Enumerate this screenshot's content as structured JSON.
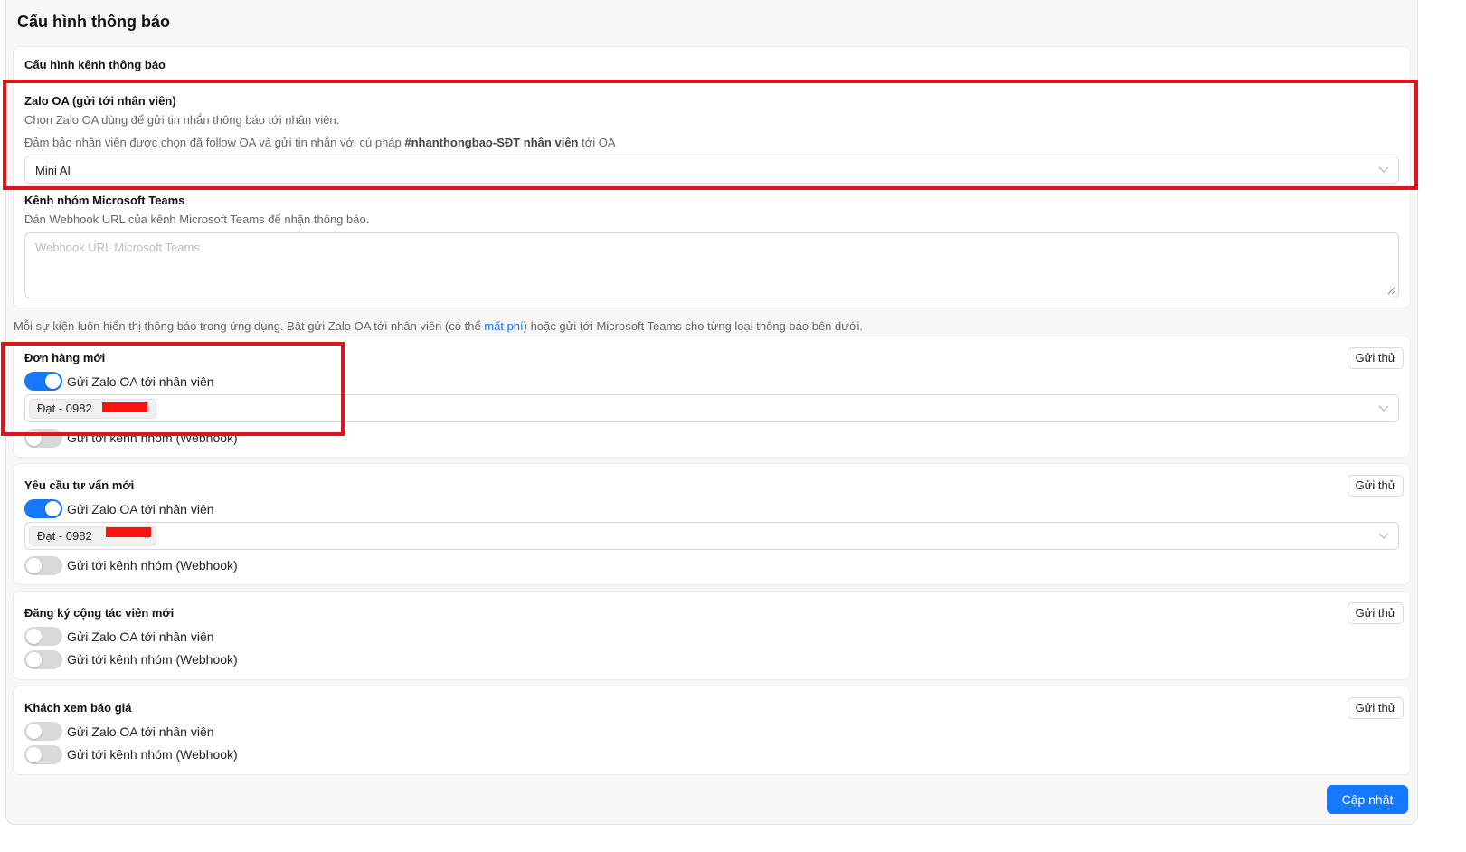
{
  "page": {
    "title": "Cấu hình thông báo"
  },
  "channels": {
    "section_title": "Cấu hình kênh thông báo",
    "zalo": {
      "label": "Zalo OA (gửi tới nhân viên)",
      "help1": "Chọn Zalo OA dùng để gửi tin nhắn thông báo tới nhân viên.",
      "help2_prefix": "Đảm bảo nhân viên được chọn đã follow OA và gửi tin nhắn với cú pháp ",
      "help2_syntax": "#nhanthongbao-SĐT nhân viên",
      "help2_suffix": " tới OA",
      "selected": "Mini AI"
    },
    "teams": {
      "label": "Kênh nhóm Microsoft Teams",
      "help": "Dán Webhook URL của kênh Microsoft Teams để nhận thông báo.",
      "placeholder": "Webhook URL Microsoft Teams"
    }
  },
  "note": {
    "prefix": "Mỗi sự kiện luôn hiển thị thông báo trong ứng dụng. Bật gửi Zalo OA tới nhân viên (có thể ",
    "link": "mất phí",
    "suffix": ") hoặc gửi tới Microsoft Teams cho từng loại thông báo bên dưới."
  },
  "events": [
    {
      "title": "Đơn hàng mới",
      "test_label": "Gửi thử",
      "zalo_label": "Gửi Zalo OA tới nhân viên",
      "zalo_on": true,
      "recipient": "Đạt - 0982",
      "webhook_label": "Gửi tới kênh nhóm (Webhook)",
      "webhook_on": false
    },
    {
      "title": "Yêu cầu tư vấn mới",
      "test_label": "Gửi thử",
      "zalo_label": "Gửi Zalo OA tới nhân viên",
      "zalo_on": true,
      "recipient": "Đạt - 0982",
      "webhook_label": "Gửi tới kênh nhóm (Webhook)",
      "webhook_on": false
    },
    {
      "title": "Đăng ký cộng tác viên mới",
      "test_label": "Gửi thử",
      "zalo_label": "Gửi Zalo OA tới nhân viên",
      "zalo_on": false,
      "webhook_label": "Gửi tới kênh nhóm (Webhook)",
      "webhook_on": false
    },
    {
      "title": "Khách xem báo giá",
      "test_label": "Gửi thử",
      "zalo_label": "Gửi Zalo OA tới nhân viên",
      "zalo_on": false,
      "webhook_label": "Gửi tới kênh nhóm (Webhook)",
      "webhook_on": false
    }
  ],
  "footer": {
    "update_label": "Cập nhật"
  },
  "colors": {
    "primary": "#1677ff",
    "highlight": "#e1141c",
    "redaction": "#ff1010"
  }
}
